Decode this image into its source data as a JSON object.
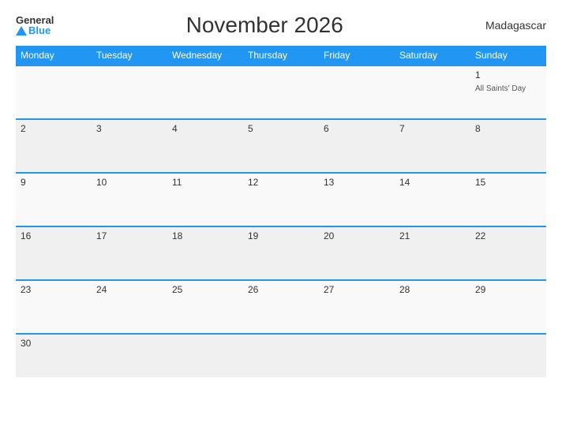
{
  "header": {
    "logo_general": "General",
    "logo_blue": "Blue",
    "title": "November 2026",
    "country": "Madagascar"
  },
  "weekdays": [
    "Monday",
    "Tuesday",
    "Wednesday",
    "Thursday",
    "Friday",
    "Saturday",
    "Sunday"
  ],
  "weeks": [
    [
      {
        "day": "",
        "event": ""
      },
      {
        "day": "",
        "event": ""
      },
      {
        "day": "",
        "event": ""
      },
      {
        "day": "",
        "event": ""
      },
      {
        "day": "",
        "event": ""
      },
      {
        "day": "",
        "event": ""
      },
      {
        "day": "1",
        "event": "All Saints' Day"
      }
    ],
    [
      {
        "day": "2",
        "event": ""
      },
      {
        "day": "3",
        "event": ""
      },
      {
        "day": "4",
        "event": ""
      },
      {
        "day": "5",
        "event": ""
      },
      {
        "day": "6",
        "event": ""
      },
      {
        "day": "7",
        "event": ""
      },
      {
        "day": "8",
        "event": ""
      }
    ],
    [
      {
        "day": "9",
        "event": ""
      },
      {
        "day": "10",
        "event": ""
      },
      {
        "day": "11",
        "event": ""
      },
      {
        "day": "12",
        "event": ""
      },
      {
        "day": "13",
        "event": ""
      },
      {
        "day": "14",
        "event": ""
      },
      {
        "day": "15",
        "event": ""
      }
    ],
    [
      {
        "day": "16",
        "event": ""
      },
      {
        "day": "17",
        "event": ""
      },
      {
        "day": "18",
        "event": ""
      },
      {
        "day": "19",
        "event": ""
      },
      {
        "day": "20",
        "event": ""
      },
      {
        "day": "21",
        "event": ""
      },
      {
        "day": "22",
        "event": ""
      }
    ],
    [
      {
        "day": "23",
        "event": ""
      },
      {
        "day": "24",
        "event": ""
      },
      {
        "day": "25",
        "event": ""
      },
      {
        "day": "26",
        "event": ""
      },
      {
        "day": "27",
        "event": ""
      },
      {
        "day": "28",
        "event": ""
      },
      {
        "day": "29",
        "event": ""
      }
    ],
    [
      {
        "day": "30",
        "event": ""
      },
      {
        "day": "",
        "event": ""
      },
      {
        "day": "",
        "event": ""
      },
      {
        "day": "",
        "event": ""
      },
      {
        "day": "",
        "event": ""
      },
      {
        "day": "",
        "event": ""
      },
      {
        "day": "",
        "event": ""
      }
    ]
  ]
}
